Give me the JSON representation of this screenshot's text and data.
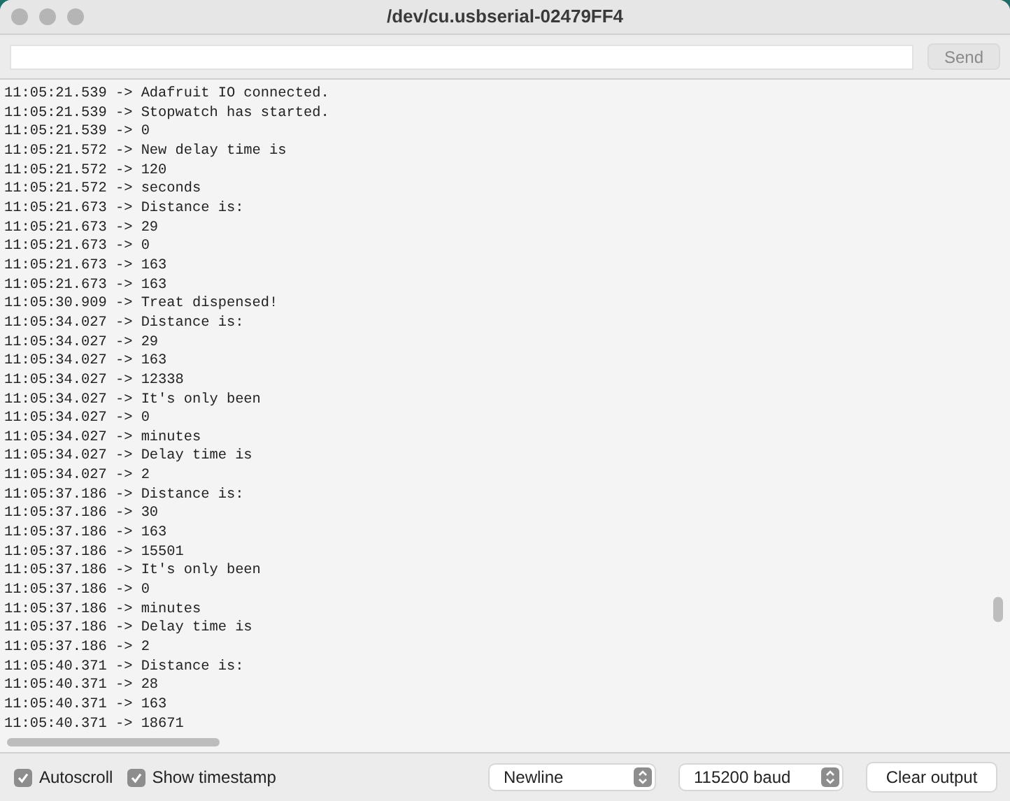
{
  "window": {
    "title": "/dev/cu.usbserial-02479FF4"
  },
  "send_button": "Send",
  "output_lines": [
    "11:05:21.539 -> Adafruit IO connected.",
    "11:05:21.539 -> Stopwatch has started.",
    "11:05:21.539 -> 0",
    "11:05:21.572 -> New delay time is",
    "11:05:21.572 -> 120",
    "11:05:21.572 -> seconds",
    "11:05:21.673 -> Distance is:",
    "11:05:21.673 -> 29",
    "11:05:21.673 -> 0",
    "11:05:21.673 -> 163",
    "11:05:21.673 -> 163",
    "11:05:30.909 -> Treat dispensed!",
    "11:05:34.027 -> Distance is:",
    "11:05:34.027 -> 29",
    "11:05:34.027 -> 163",
    "11:05:34.027 -> 12338",
    "11:05:34.027 -> It's only been",
    "11:05:34.027 -> 0",
    "11:05:34.027 -> minutes",
    "11:05:34.027 -> Delay time is",
    "11:05:34.027 -> 2",
    "11:05:37.186 -> Distance is:",
    "11:05:37.186 -> 30",
    "11:05:37.186 -> 163",
    "11:05:37.186 -> 15501",
    "11:05:37.186 -> It's only been",
    "11:05:37.186 -> 0",
    "11:05:37.186 -> minutes",
    "11:05:37.186 -> Delay time is",
    "11:05:37.186 -> 2",
    "11:05:40.371 -> Distance is:",
    "11:05:40.371 -> 28",
    "11:05:40.371 -> 163",
    "11:05:40.371 -> 18671"
  ],
  "options": [
    {
      "label": "Autoscroll",
      "checked": true
    },
    {
      "label": "Show timestamp",
      "checked": true
    }
  ],
  "line_ending": "Newline",
  "baud_rate": "115200 baud",
  "clear_button": "Clear output"
}
